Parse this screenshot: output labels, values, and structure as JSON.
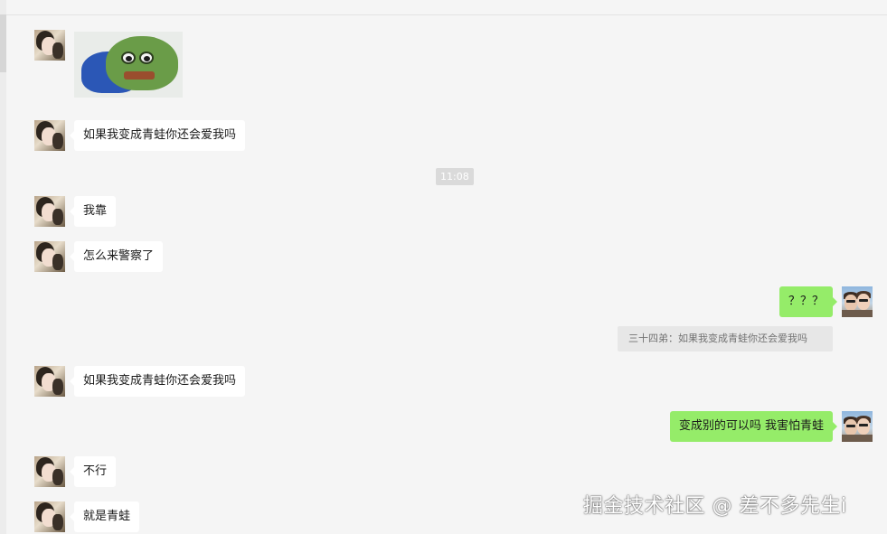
{
  "messages": {
    "m1": "如果我变成青蛙你还会爱我吗",
    "m2": "我靠",
    "m3": "怎么来警察了",
    "m4": "？？？",
    "m5_quote": "三十四弟：如果我变成青蛙你还会爱我吗",
    "m6": "如果我变成青蛙你还会爱我吗",
    "m7": "变成别的可以吗  我害怕青蛙",
    "m8": "不行",
    "m9": "就是青蛙"
  },
  "time_divider": "11:08",
  "sticker": {
    "icon": "pepe-frog-sticker"
  },
  "watermark": "掘金技术社区 @ 差不多先生i",
  "colors": {
    "background": "#f5f5f5",
    "incoming_bubble": "#ffffff",
    "outgoing_bubble": "#95ec69",
    "quote_bg": "#e7e7e7"
  }
}
